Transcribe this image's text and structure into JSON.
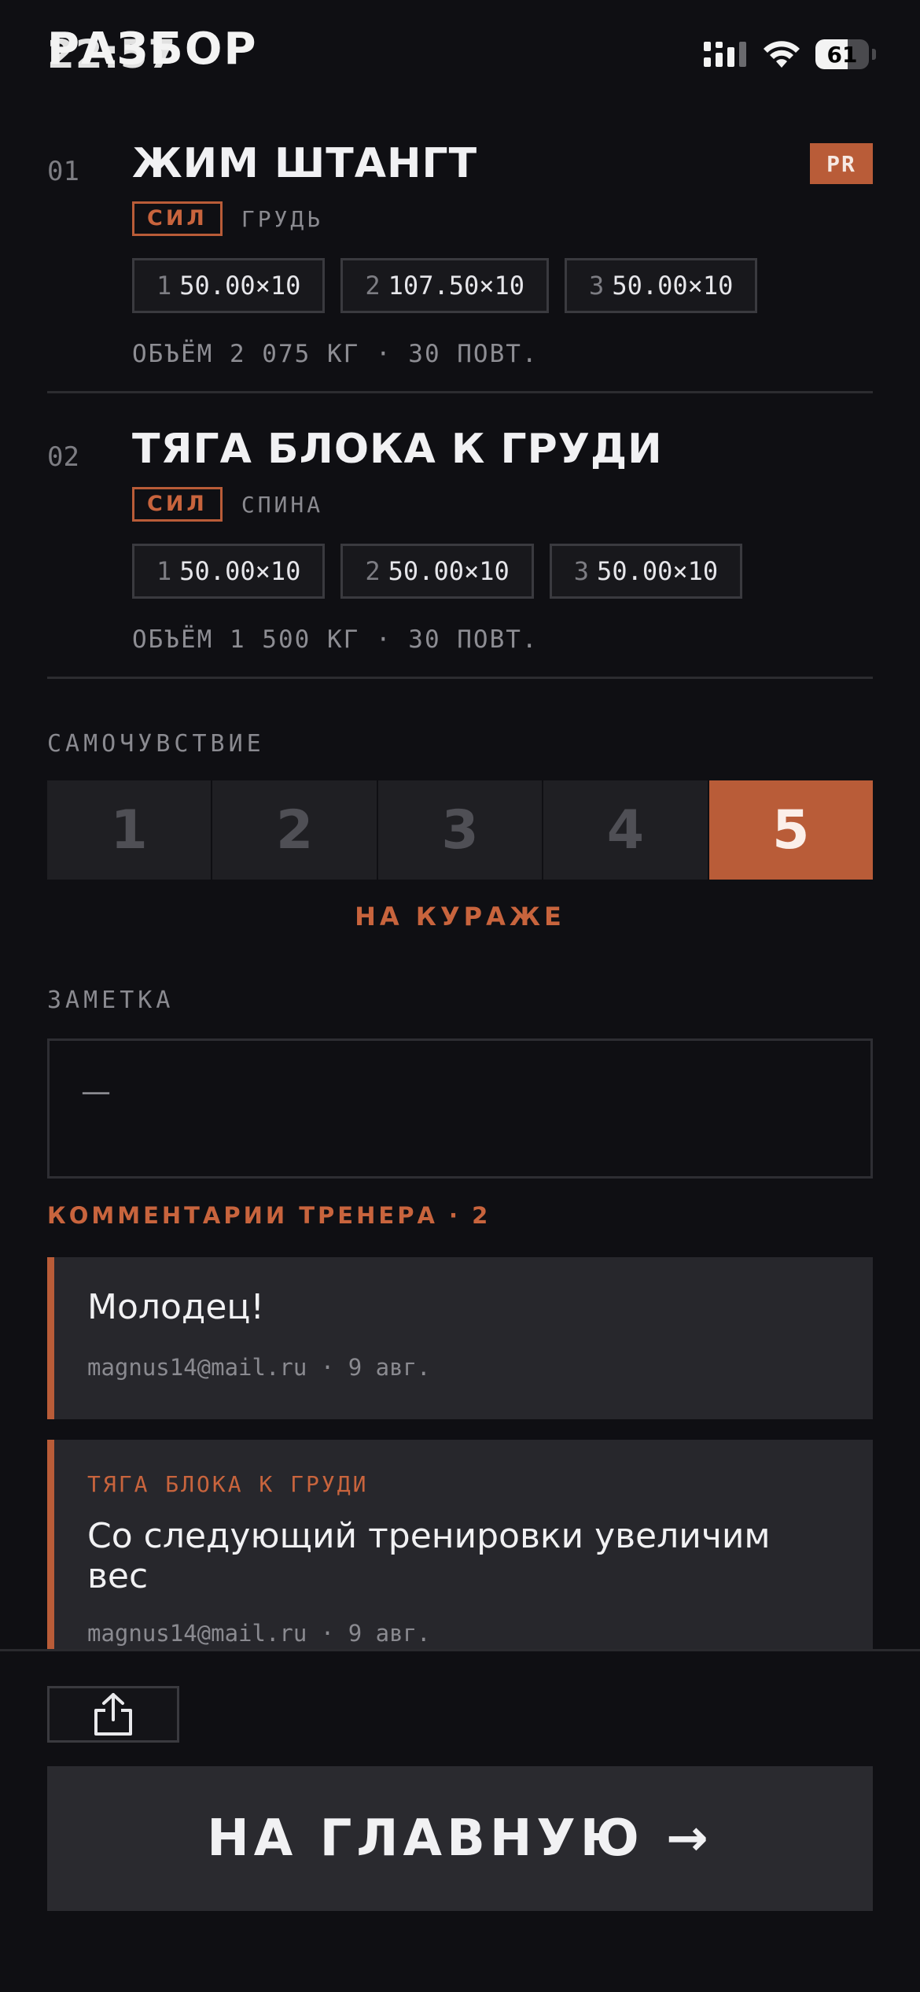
{
  "header": {
    "title": "РАЗБОР",
    "status_time": "22:57"
  },
  "status_bar": {
    "battery_level": "61",
    "battery_fraction": 0.61
  },
  "exercises": [
    {
      "index": "01",
      "name": "ЖИМ ШТАНГТ",
      "pr_badge": "PR",
      "tag": "СИЛ",
      "muscle": "ГРУДЬ",
      "sets": [
        {
          "n": "1",
          "value": "50.00×10"
        },
        {
          "n": "2",
          "value": "107.50×10"
        },
        {
          "n": "3",
          "value": "50.00×10"
        }
      ],
      "volume": "ОБЪЁМ 2 075 КГ · 30 ПОВТ."
    },
    {
      "index": "02",
      "name": "ТЯГА БЛОКА К ГРУДИ",
      "tag": "СИЛ",
      "muscle": "СПИНА",
      "sets": [
        {
          "n": "1",
          "value": "50.00×10"
        },
        {
          "n": "2",
          "value": "50.00×10"
        },
        {
          "n": "3",
          "value": "50.00×10"
        }
      ],
      "volume": "ОБЪЁМ 1 500 КГ · 30 ПОВТ."
    }
  ],
  "wellbeing": {
    "label": "САМОЧУВСТВИЕ",
    "options": [
      "1",
      "2",
      "3",
      "4",
      "5"
    ],
    "selected": "5",
    "caption": "НА КУРАЖЕ"
  },
  "note": {
    "label": "ЗАМЕТКА",
    "value": "—"
  },
  "comments": {
    "title": "КОММЕНТАРИИ ТРЕНЕРА · 2",
    "items": [
      {
        "exercise": "",
        "text": "Молодец!",
        "meta": "magnus14@mail.ru · 9 авг."
      },
      {
        "exercise": "ТЯГА БЛОКА К ГРУДИ",
        "text": "Со следующий тренировки увеличим вес",
        "meta": "magnus14@mail.ru · 9 авг."
      }
    ]
  },
  "actions": {
    "share_icon": "share-icon",
    "home_label": "НА ГЛАВНУЮ →"
  },
  "colors": {
    "background": "#0f0f13",
    "accent": "#b95c38",
    "card": "#27272c"
  }
}
